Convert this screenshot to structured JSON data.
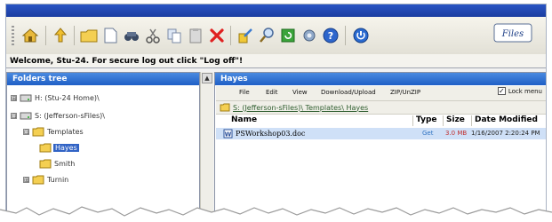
{
  "colors": {
    "accent": "#1f5fc6",
    "path": "#2e5d2e",
    "size": "#c03030",
    "link": "#2f73c2"
  },
  "toolbar": {
    "buttons": [
      {
        "name": "home-icon"
      },
      {
        "name": "up-folder-icon"
      },
      {
        "name": "new-folder-icon"
      },
      {
        "name": "new-file-icon"
      },
      {
        "name": "properties-icon"
      },
      {
        "name": "cut-icon"
      },
      {
        "name": "copy-icon"
      },
      {
        "name": "paste-icon"
      },
      {
        "name": "delete-icon"
      },
      {
        "name": "rename-icon"
      },
      {
        "name": "search-icon"
      },
      {
        "name": "refresh-icon"
      },
      {
        "name": "settings-icon"
      },
      {
        "name": "help-icon"
      },
      {
        "name": "logoff-icon"
      }
    ],
    "brand": "Files"
  },
  "welcome": "Welcome, Stu-24. For secure log out click \"Log off\"!",
  "left_panel": {
    "title": "Folders tree",
    "tree": [
      {
        "label": "H: (Stu-24 Home)\\",
        "expander": "⊞",
        "icon": "drive-icon"
      },
      {
        "label": "S: (Jefferson-sFiles)\\",
        "expander": "⊟",
        "icon": "drive-icon"
      },
      {
        "label": "Templates",
        "expander": "⊟",
        "icon": "folder-icon"
      },
      {
        "label": "Hayes",
        "expander": "",
        "icon": "folder-icon",
        "selected": true
      },
      {
        "label": "Smith",
        "expander": "",
        "icon": "folder-icon"
      },
      {
        "label": "Turnin",
        "expander": "⊞",
        "icon": "folder-icon"
      }
    ]
  },
  "right_panel": {
    "title": "Hayes",
    "menu": [
      "File",
      "Edit",
      "View",
      "Download/Upload",
      "ZIP/UnZIP"
    ],
    "lock_menu": {
      "label": "Lock menu",
      "checked": true
    },
    "path": "S: (Jefferson-sFiles)\\ Templates\\ Hayes",
    "columns": [
      "Name",
      "Type",
      "Size",
      "Date Modified"
    ],
    "files": [
      {
        "name": "PSWorkshop03.doc",
        "type": "Get",
        "size": "3.0 MB",
        "date": "1/16/2007 2:20:24 PM"
      }
    ]
  }
}
